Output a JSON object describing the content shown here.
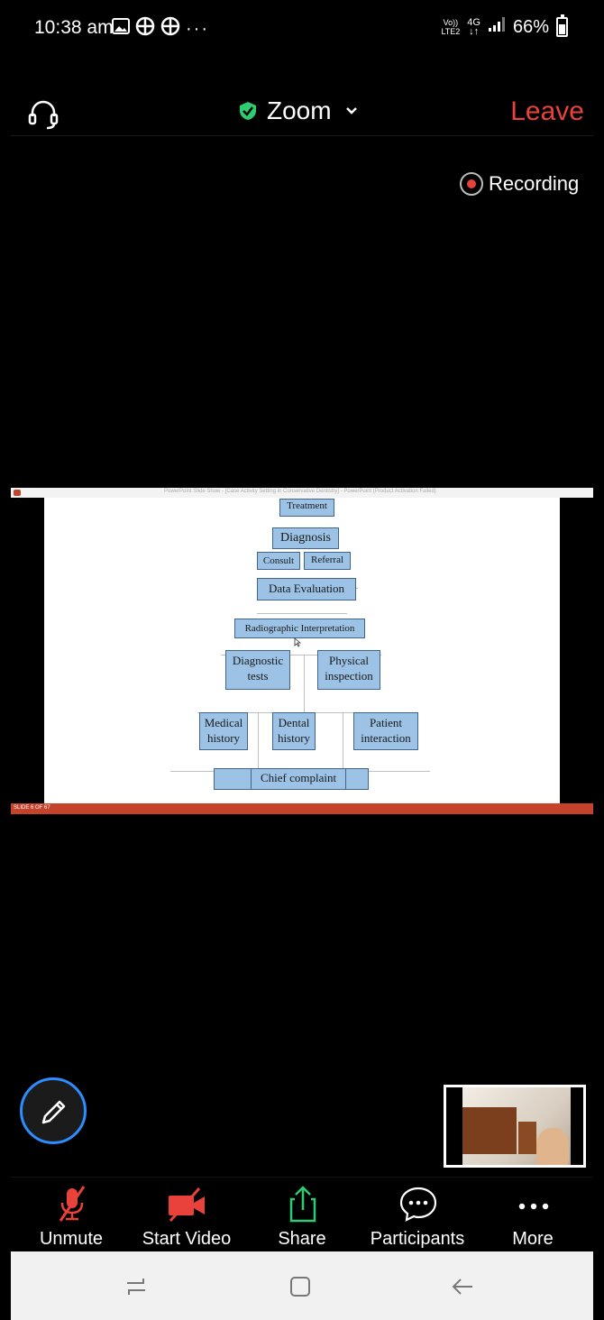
{
  "status_bar": {
    "time": "10:38 am",
    "network_top": "Vo))",
    "network_bottom": "LTE2",
    "network_type": "4G",
    "battery": "66%",
    "icons": [
      "gallery-icon",
      "app-icon",
      "app-icon",
      "more-notifications-icon"
    ]
  },
  "meeting": {
    "title": "Zoom",
    "leave_label": "Leave",
    "recording_label": "Recording",
    "secure_color": "#2ecc71",
    "leave_color": "#e8423b",
    "accent_color": "#2d8cff"
  },
  "shared_slide": {
    "window_title": "PowerPoint Slide Show - [Case Activity Setting in Conservative Dentistry] - PowerPoint (Product Activation Failed)",
    "slide_indicator": "SLIDE 6 OF 67",
    "boxes": {
      "treatment": "Treatment",
      "diagnosis": "Diagnosis",
      "consult": "Consult",
      "referral": "Referral",
      "data_evaluation": "Data Evaluation",
      "radiographic": "Radiographic Interpretation",
      "diagnostic_tests": "Diagnostic tests",
      "physical_inspection": "Physical inspection",
      "medical_history": "Medical history",
      "dental_history": "Dental history",
      "patient_interaction": "Patient interaction",
      "chief_complaint": "Chief complaint"
    }
  },
  "toolbar": {
    "unmute": "Unmute",
    "start_video": "Start Video",
    "share": "Share",
    "participants": "Participants",
    "more": "More"
  }
}
